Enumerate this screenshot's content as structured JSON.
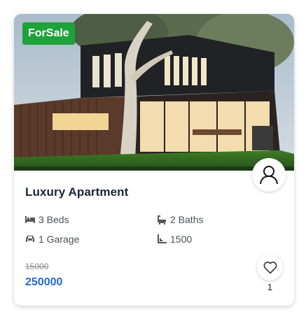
{
  "listing": {
    "badge": "ForSale",
    "title": "Luxury Apartment",
    "features": {
      "beds": "3 Beds",
      "baths": "2 Baths",
      "garage": "1 Garage",
      "area": "1500"
    },
    "old_price": "15000",
    "price": "250000",
    "likes": "1"
  },
  "icons": {
    "beds": "bed-icon",
    "baths": "bathtub-icon",
    "garage": "car-icon",
    "area": "area-icon",
    "avatar": "user-icon",
    "like": "heart-icon"
  },
  "colors": {
    "badge": "#1ea23a",
    "price": "#2469d0",
    "title": "#1b2434"
  }
}
